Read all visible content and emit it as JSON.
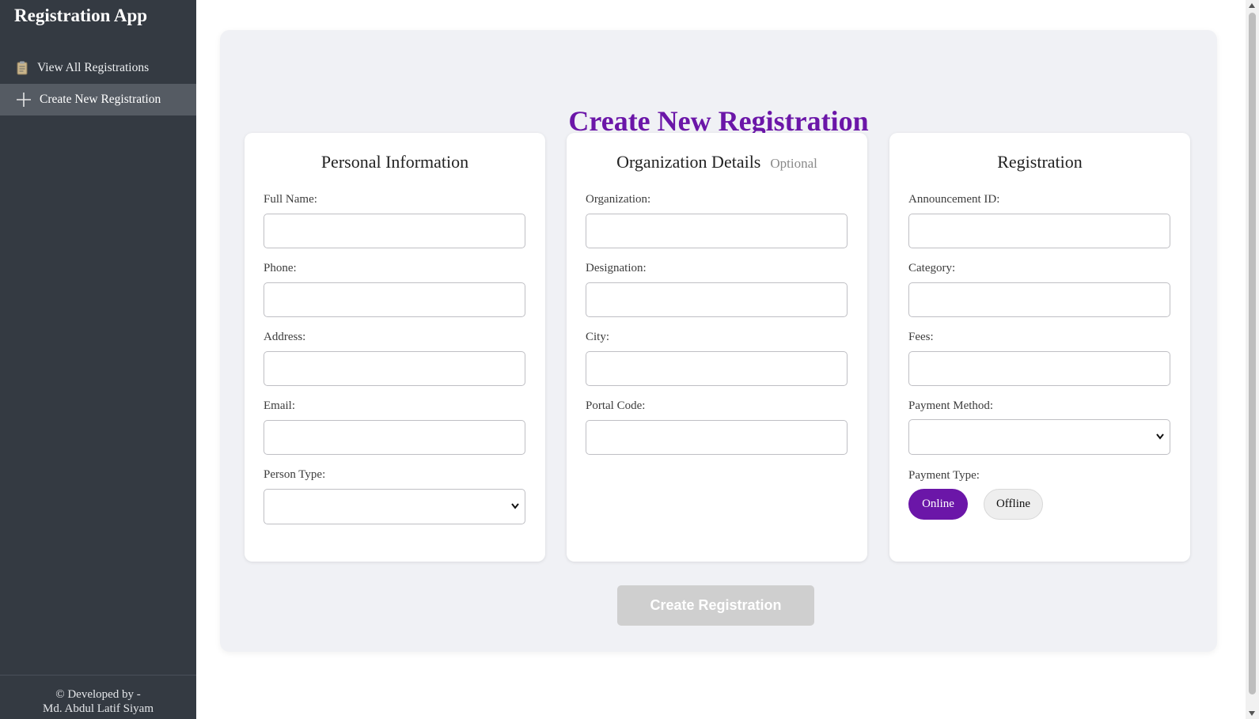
{
  "sidebar": {
    "app_title": "Registration App",
    "items": [
      {
        "label": "View All Registrations",
        "icon": "clipboard-icon"
      },
      {
        "label": "Create New Registration",
        "icon": "plus-icon",
        "active": true
      }
    ],
    "footer_line1": "© Developed by -",
    "footer_line2": "Md. Abdul Latif Siyam"
  },
  "main": {
    "title": "Create New Registration",
    "accent_color": "#6b16a8",
    "personal": {
      "title": "Personal Information",
      "full_name_label": "Full Name:",
      "phone_label": "Phone:",
      "address_label": "Address:",
      "email_label": "Email:",
      "person_type_label": "Person Type:"
    },
    "organization": {
      "title": "Organization Details",
      "optional": "Optional",
      "organization_label": "Organization:",
      "designation_label": "Designation:",
      "city_label": "City:",
      "portal_code_label": "Portal Code:"
    },
    "registration": {
      "title": "Registration",
      "announcement_label": "Announcement ID:",
      "category_label": "Category:",
      "fees_label": "Fees:",
      "payment_method_label": "Payment Method:",
      "payment_type_label": "Payment Type:",
      "online_label": "Online",
      "offline_label": "Offline",
      "selected_payment_type": "Online"
    },
    "submit_label": "Create Registration"
  }
}
